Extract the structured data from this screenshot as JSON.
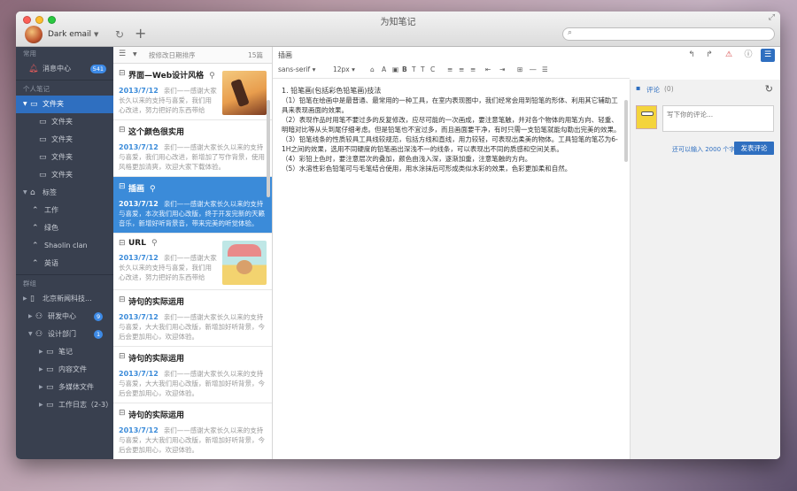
{
  "window": {
    "title": "为知笔记"
  },
  "user": {
    "name": "Dark email"
  },
  "search": {
    "placeholder": ""
  },
  "sidebar": {
    "section_common": "常用",
    "unread": {
      "label": "消息中心",
      "badge": "541"
    },
    "section_personal": "个人笔记",
    "folders": [
      {
        "label": "文件夹",
        "active": true
      },
      {
        "label": "文件夹"
      },
      {
        "label": "文件夹"
      },
      {
        "label": "文件夹"
      },
      {
        "label": "文件夹"
      }
    ],
    "tags_label": "标签",
    "tags": [
      "工作",
      "绿色",
      "Shaolin clan",
      "英语"
    ],
    "section_group": "群组",
    "group_root": "北京新闻科技...",
    "group_items": [
      {
        "label": "研发中心",
        "badge": "9"
      },
      {
        "label": "设计部门",
        "badge": "1"
      }
    ],
    "group_sub": [
      "笔记",
      "内容文件",
      "多媒体文件",
      "工作日志（2-3）"
    ]
  },
  "notelist": {
    "sort_label": "按修改日期排序",
    "count": "15篇",
    "notes": [
      {
        "title": "界面—Web设计风格",
        "date": "2013/7/12",
        "snippet": "亲们——感谢大家长久以来的支持与喜爱，我们用心改进，努力把好的东西带给你。",
        "thumb": "a",
        "clip": true
      },
      {
        "title": "这个颜色很实用",
        "date": "2013/7/12",
        "snippet": "亲们——感谢大家长久以来的支持与喜爱，我们用心改进，新增加了写作背景，使用风格更加清爽，欢迎大家下载体验。"
      },
      {
        "title": "插画",
        "date": "2013/7/12",
        "snippet": "亲们——感谢大家长久以来的支持与喜爱，本次我们用心改版，终于开发完新的天籁音乐，新增好听背景音，带来完美的听觉体验。",
        "selected": true,
        "clip": true
      },
      {
        "title": "URL",
        "date": "2013/7/12",
        "snippet": "亲们——感谢大家长久以来的支持与喜爱，我们用心改进，努力把好的东西带给你。",
        "thumb": "b",
        "clip": true
      },
      {
        "title": "诗句的实际运用",
        "date": "2013/7/12",
        "snippet": "亲们——感谢大家长久以来的支持与喜爱，大大我们用心改版，新增加好听背景，今后会更加用心，欢迎体验。"
      },
      {
        "title": "诗句的实际运用",
        "date": "2013/7/12",
        "snippet": "亲们——感谢大家长久以来的支持与喜爱，大大我们用心改版，新增加好听背景，今后会更加用心，欢迎体验。"
      },
      {
        "title": "诗句的实际运用",
        "date": "2013/7/12",
        "snippet": "亲们——感谢大家长久以来的支持与喜爱，大大我们用心改版，新增加好听背景，今后会更加用心，欢迎体验。"
      }
    ]
  },
  "editor": {
    "title": "插画",
    "font_family": "sans-serif",
    "font_size": "12px",
    "paragraphs": [
      "1. 铅笔画(包括彩色铅笔画)技法",
      "（1）铅笔在绘画中是最普通、最常用的一种工具，在室内表现图中，我们经常会用到铅笔的形体、利用其它辅助工具来表现画面的效果。",
      "（2）表现作品时用笔不要过多的反复修改，应尽可能的一次画成，要注意笔触，并对各个物体的用笔方向、轻重、明暗对比等从头到尾仔细考虑。但是铅笔也不宜过多，而且画面要干净，有时只需一支铅笔就能勾勒出完美的效果。",
      "（3）铅笔线条的性质较具工具线较规范，包括方线和直线，用力较轻，可表现出柔美的物体。工具铅笔的笔芯为6-1H之间的效果，选用不同硬度的铅笔画出深浅不一的线条，可以表现出不同的质感和空间关系。",
      "（4）彩铅上色时，要注意层次的叠加，颜色由浅入深，逐渐加重，注意笔触的方向。",
      "（5）水溶性彩色铅笔可与毛笔结合使用，用水涂抹后可形成类似水彩的效果，色彩更加柔和自然。"
    ]
  },
  "comments": {
    "label": "评论",
    "count": "(0)",
    "placeholder": "写下你的评论...",
    "hint": "还可以输入 2000 个字",
    "submit": "发表评论"
  }
}
